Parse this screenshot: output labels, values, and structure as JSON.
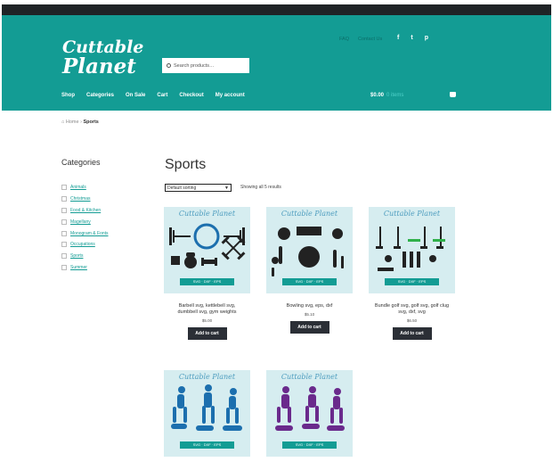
{
  "header": {
    "logo_line1": "Cuttable",
    "logo_line2": "Planet",
    "search_placeholder": "Search products…",
    "top_links": [
      "FAQ",
      "Contact Us"
    ],
    "social_icons": [
      "facebook-icon",
      "twitter-icon",
      "pinterest-icon"
    ]
  },
  "nav": {
    "items": [
      "Shop",
      "Categories",
      "On Sale",
      "Cart",
      "Checkout",
      "My account"
    ]
  },
  "cart": {
    "amount": "$0.00",
    "items": "0 items"
  },
  "breadcrumb": {
    "home": "Home",
    "current": "Sports"
  },
  "sidebar": {
    "title": "Categories",
    "categories": [
      "Animals",
      "Christmas",
      "Food & Kitchen",
      "Magellany",
      "Monogram & Fonts",
      "Occupations",
      "Sports",
      "Summer"
    ]
  },
  "main": {
    "title": "Sports",
    "sort_selected": "Default sorting",
    "results_text": "Showing all 5 results",
    "products": [
      {
        "name_line1": "Barbell svg, kettlebell svg,",
        "name_line2": "dumbbell svg, gym weights",
        "price": "$5.00",
        "button": "Add to cart",
        "brand": "Cuttable Planet",
        "ribbon": "SVG · DXF · EPS"
      },
      {
        "name_line1": "Bowling svg, eps, dxf",
        "name_line2": "",
        "price": "$5.10",
        "button": "Add to cart",
        "brand": "Cuttable Planet",
        "ribbon": "SVG · DXF · EPS"
      },
      {
        "name_line1": "Bundle golf svg, golf svg, golf clug",
        "name_line2": "svg, dxf, svg",
        "price": "$6.50",
        "button": "Add to cart",
        "brand": "Cuttable Planet",
        "ribbon": "SVG · DXF · EPS"
      },
      {
        "name_line1": "",
        "name_line2": "",
        "price": "",
        "button": "",
        "brand": "Cuttable Planet",
        "ribbon": "SVG · DXF · EPS"
      },
      {
        "name_line1": "",
        "name_line2": "",
        "price": "",
        "button": "",
        "brand": "Cuttable Planet",
        "ribbon": "SVG · DXF · EPS"
      }
    ]
  },
  "colors": {
    "brand_teal": "#139c94",
    "topbar": "#1f2326",
    "button": "#2b2f36",
    "thumb_bg": "#d6edf0",
    "silhouette_dark": "#222222",
    "silhouette_blue": "#1c6fae",
    "silhouette_purple": "#6a2a8c"
  }
}
